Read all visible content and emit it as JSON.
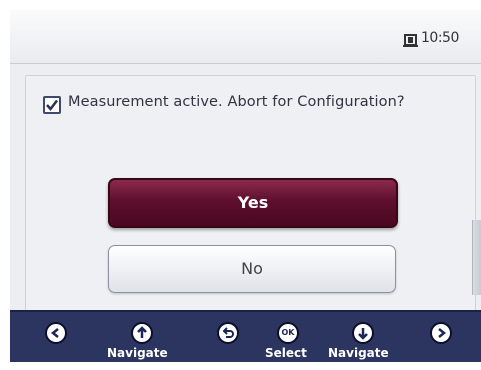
{
  "status": {
    "time": "10:50",
    "icon": "device-status-icon"
  },
  "dialog": {
    "checkbox_checked": true,
    "message": "Measurement active. Abort for Configuration?",
    "yes_label": "Yes",
    "no_label": "No"
  },
  "nav": {
    "buttons": [
      {
        "icon": "arrow-left-icon",
        "label": ""
      },
      {
        "icon": "arrow-up-icon",
        "label": "Navigate"
      },
      {
        "icon": "back-icon",
        "label": ""
      },
      {
        "icon": "ok-icon",
        "glyph": "OK",
        "label": "Select"
      },
      {
        "icon": "arrow-down-icon",
        "label": "Navigate"
      },
      {
        "icon": "arrow-right-icon",
        "label": ""
      }
    ]
  },
  "colors": {
    "accent": "#5e0f2d",
    "navbar": "#2c3460"
  }
}
